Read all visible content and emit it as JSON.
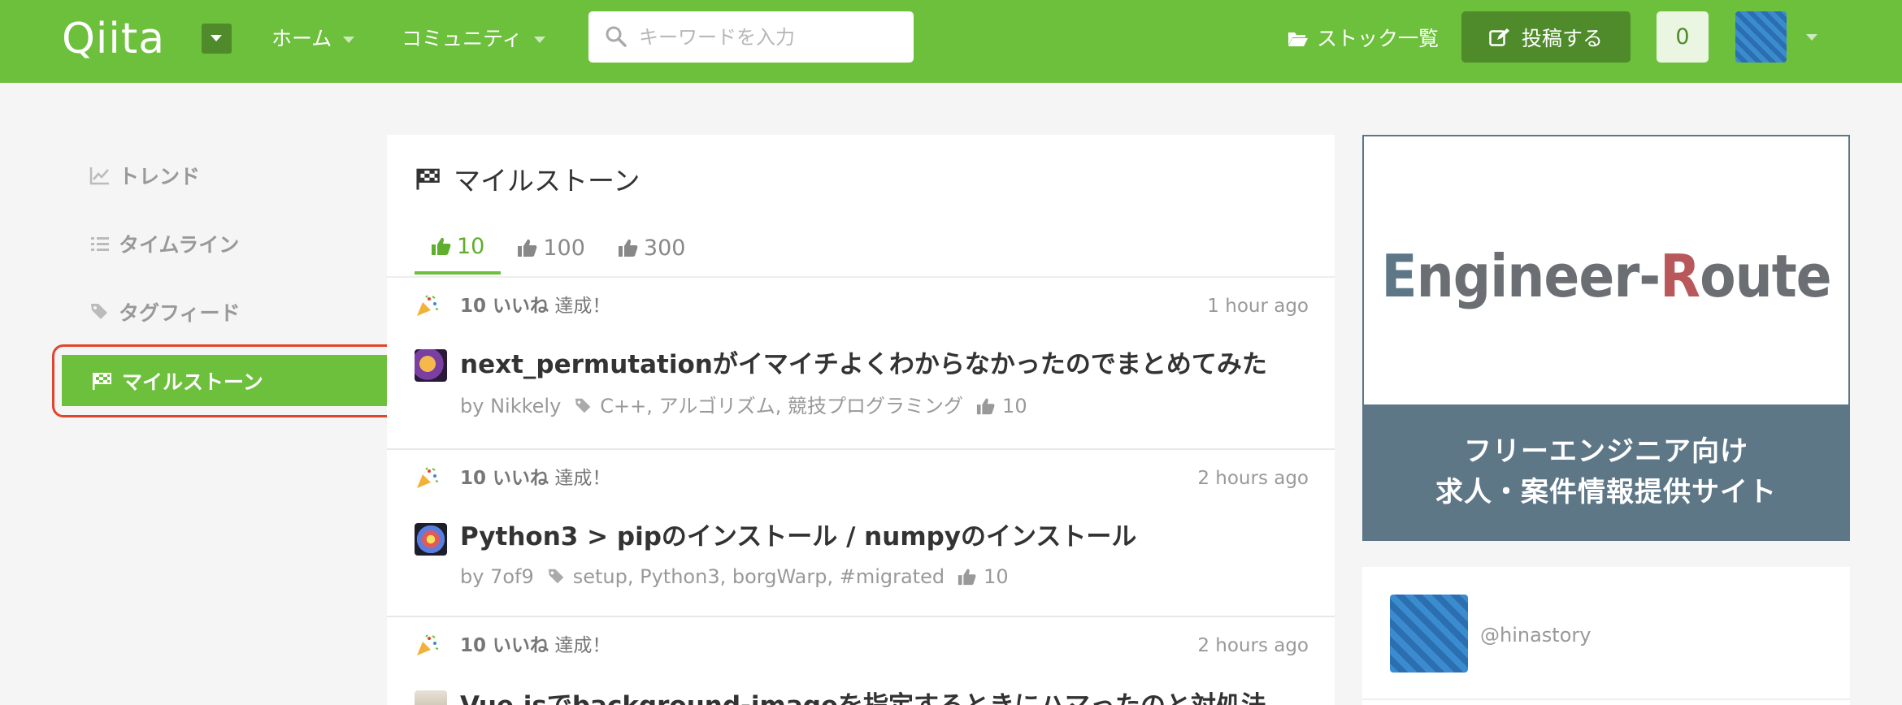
{
  "header": {
    "logo": "Qiita",
    "nav": [
      {
        "label": "ホーム"
      },
      {
        "label": "コミュニティ"
      }
    ],
    "search_placeholder": "キーワードを入力",
    "stock_label": "ストック一覧",
    "post_label": "投稿する",
    "notification_count": "0"
  },
  "sidebar": {
    "items": [
      {
        "label": "トレンド",
        "icon": "chart-line-icon"
      },
      {
        "label": "タイムライン",
        "icon": "list-icon"
      },
      {
        "label": "タグフィード",
        "icon": "tags-icon"
      },
      {
        "label": "マイルストーン",
        "icon": "flag-checkered-icon",
        "active": true
      }
    ]
  },
  "main": {
    "title": "マイルストーン",
    "tabs": [
      {
        "label": "10",
        "active": true
      },
      {
        "label": "100"
      },
      {
        "label": "300"
      }
    ],
    "items": [
      {
        "count": "10 いいね",
        "achieved": "達成！",
        "time": "1 hour ago",
        "title": "next_permutationがイマイチよくわからなかったのでまとめてみた",
        "by": "by Nikkely",
        "tags": "C++, アルゴリズム, 競技プログラミング",
        "likes": "10"
      },
      {
        "count": "10 いいね",
        "achieved": "達成！",
        "time": "2 hours ago",
        "title": "Python3 > pipのインストール / numpyのインストール",
        "by": "by 7of9",
        "tags": "setup, Python3, borgWarp, #migrated",
        "likes": "10"
      },
      {
        "count": "10 いいね",
        "achieved": "達成！",
        "time": "2 hours ago",
        "title": "Vue.jsでbackground-imageを指定するときにハマったのと対処法",
        "by": "",
        "tags": "",
        "likes": ""
      }
    ]
  },
  "ad": {
    "logo_prefix": "E",
    "logo_mid": "ngineer-",
    "logo_r": "R",
    "logo_suffix": "oute",
    "line1": "フリーエンジニア向け",
    "line2": "求人・案件情報提供サイト"
  },
  "profile": {
    "handle": "@hinastory"
  },
  "colors": {
    "brand": "#6dc03c",
    "brand_dark": "#4f8a2b",
    "highlight": "#e0452d",
    "ad_band": "#5e7787"
  }
}
